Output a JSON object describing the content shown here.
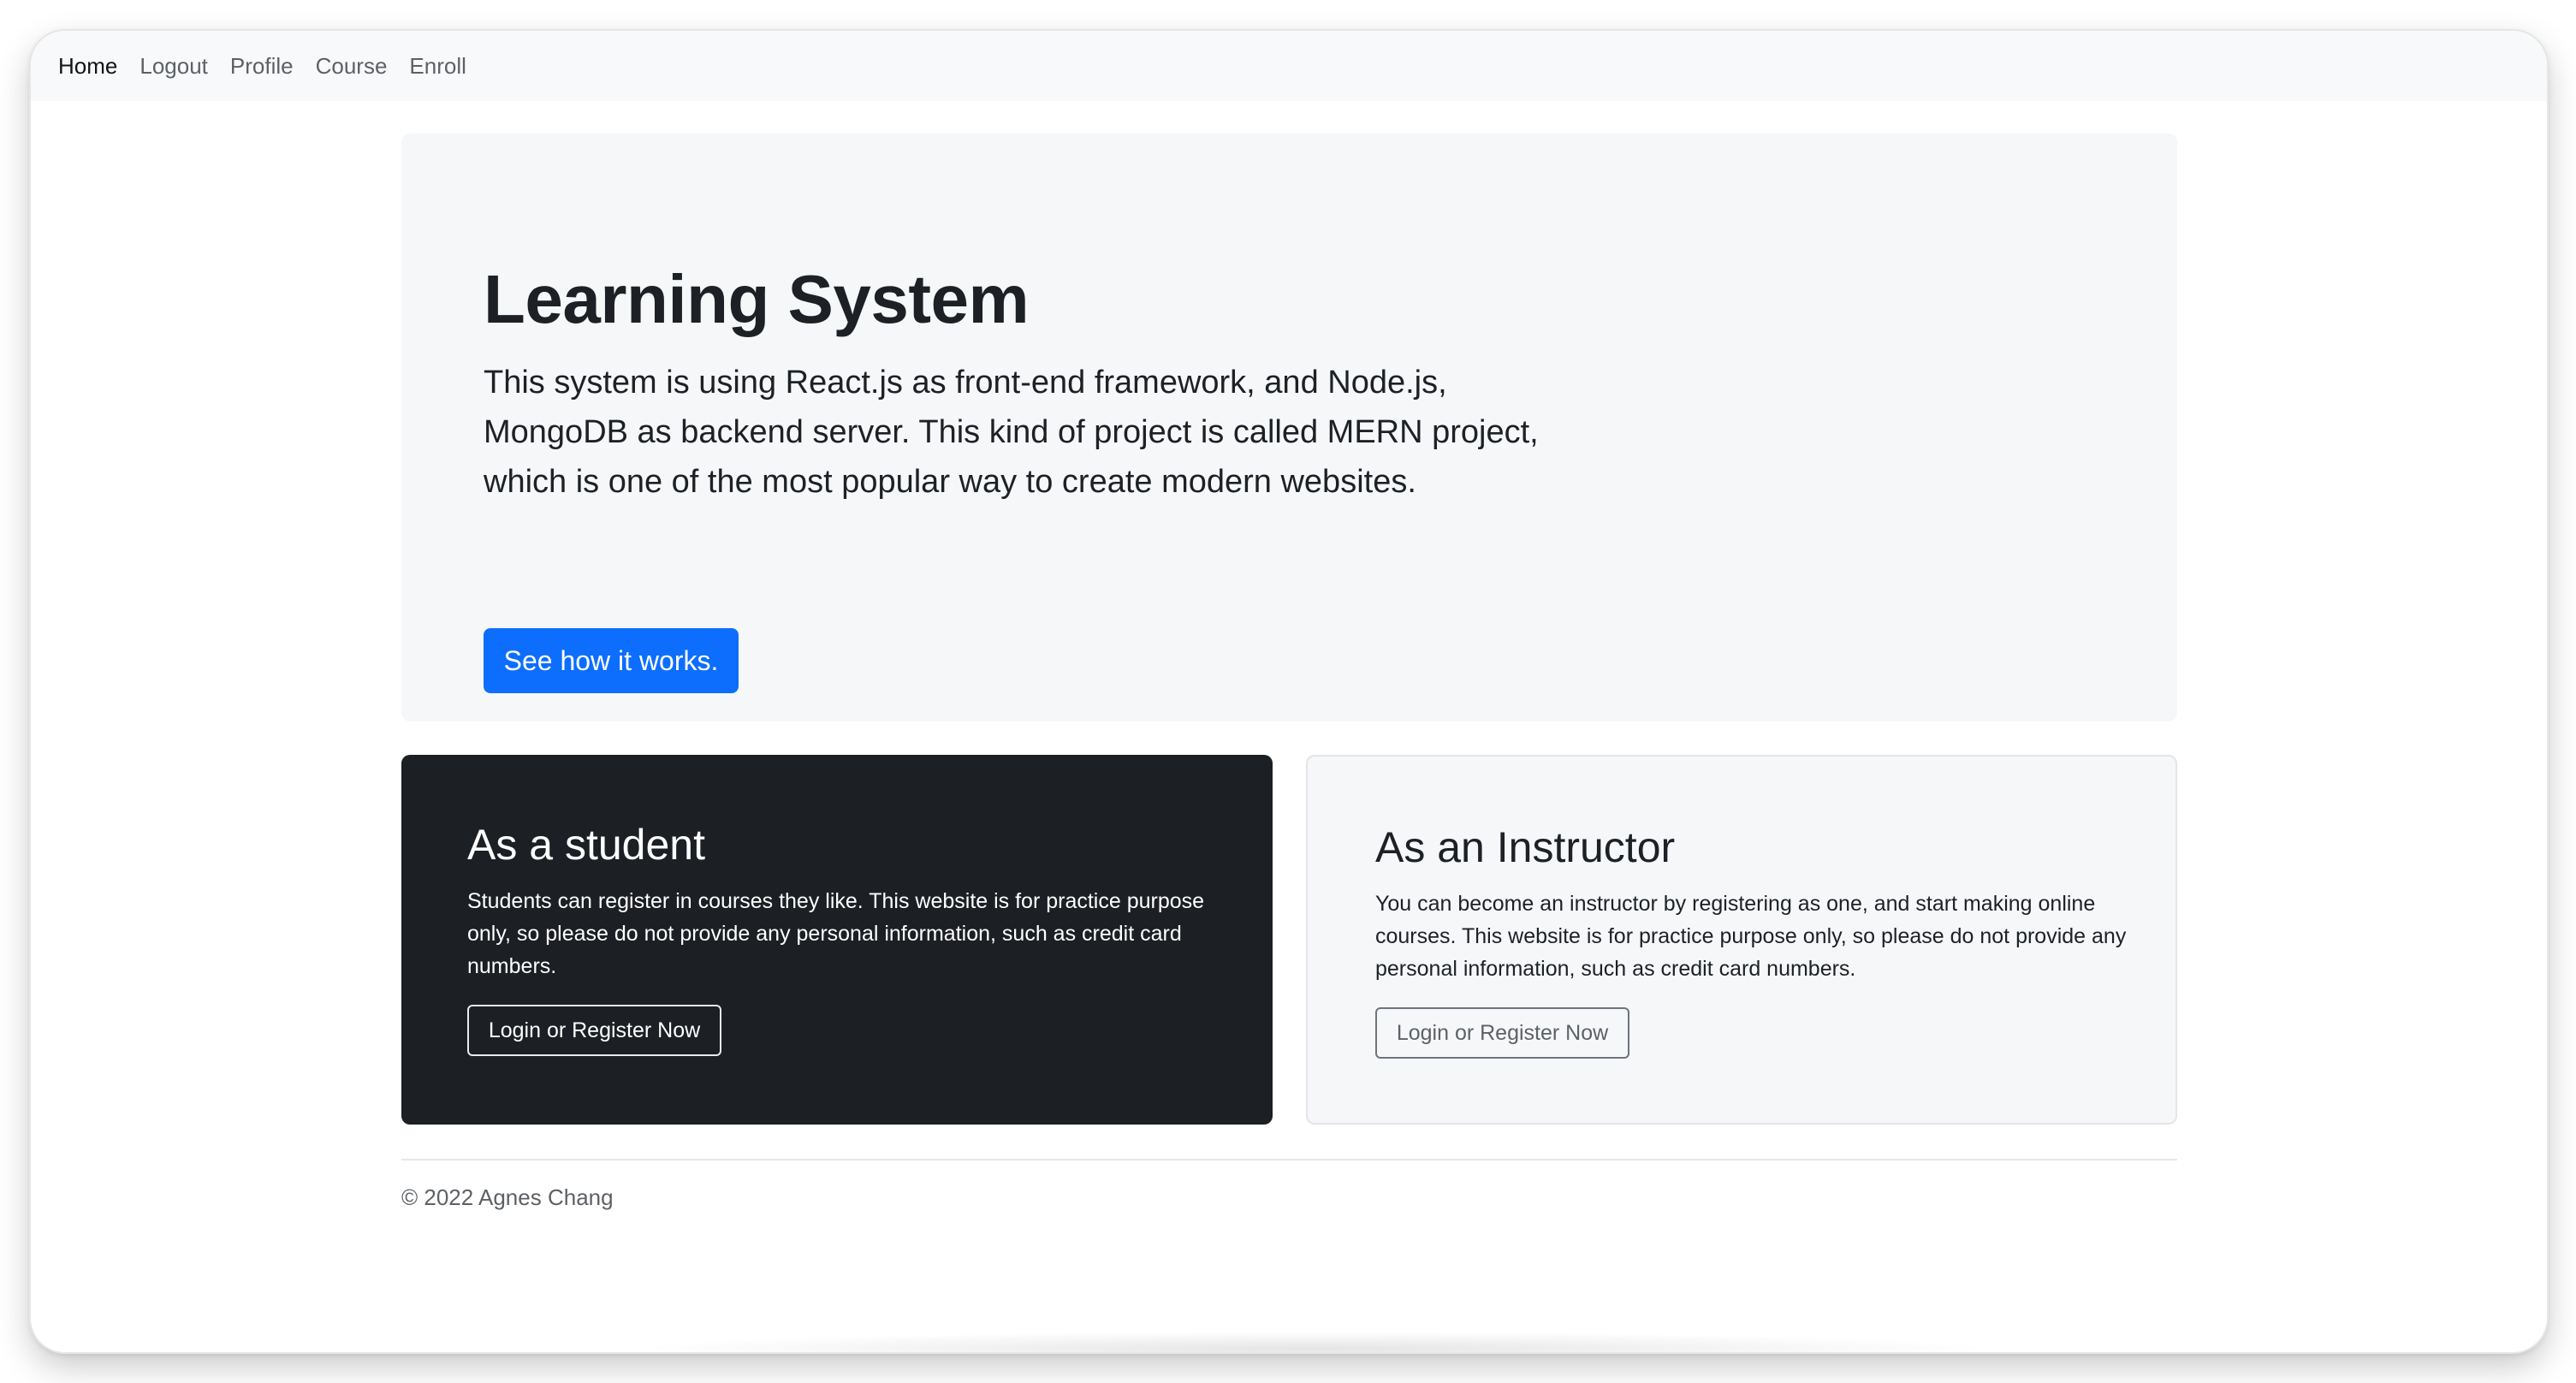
{
  "nav": {
    "items": [
      {
        "label": "Home"
      },
      {
        "label": "Logout"
      },
      {
        "label": "Profile"
      },
      {
        "label": "Course"
      },
      {
        "label": "Enroll"
      }
    ]
  },
  "hero": {
    "title": "Learning System",
    "text": "This system is using React.js as front-end framework, and Node.js, MongoDB as backend server. This kind of project is called MERN project, which is one of the most popular way to create modern websites.",
    "button_label": "See how it works."
  },
  "cards": {
    "student": {
      "title": "As a student",
      "text": "Students can register in courses they like. This website is for practice purpose only, so please do not provide any personal information, such as credit card numbers.",
      "button_label": "Login or Register Now"
    },
    "instructor": {
      "title": "As an Instructor",
      "text": "You can become an instructor by registering as one, and start making online courses. This website is for practice purpose only, so please do not provide any personal information, such as credit card numbers.",
      "button_label": "Login or Register Now"
    }
  },
  "footer": {
    "text": "© 2022 Agnes Chang"
  },
  "colors": {
    "primary": "#0d6efd",
    "dark_card": "#1c1f23",
    "light_bg": "#f6f7f9"
  }
}
